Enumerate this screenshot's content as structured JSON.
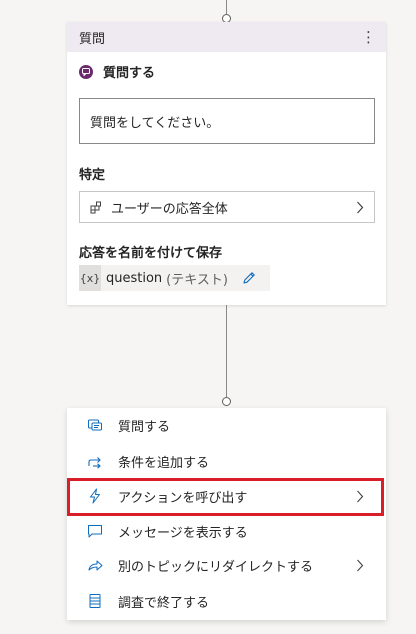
{
  "card": {
    "title": "質問",
    "kebab": "⋮",
    "section_title": "質問する",
    "prompt_text": "質問をしてください。",
    "identify_label": "特定",
    "identify_value": "ユーザーの応答全体",
    "save_label": "応答を名前を付けて保存",
    "variable_badge": "{x}",
    "variable_name": "question",
    "variable_type": "(テキスト)"
  },
  "menu": {
    "items": [
      {
        "label": "質問する",
        "icon": "question-icon",
        "has_submenu": false
      },
      {
        "label": "条件を追加する",
        "icon": "branch-icon",
        "has_submenu": false
      },
      {
        "label": "アクションを呼び出す",
        "icon": "lightning-icon",
        "has_submenu": true
      },
      {
        "label": "メッセージを表示する",
        "icon": "message-icon",
        "has_submenu": false
      },
      {
        "label": "別のトピックにリダイレクトする",
        "icon": "redirect-icon",
        "has_submenu": true
      },
      {
        "label": "調査で終了する",
        "icon": "survey-icon",
        "has_submenu": false
      }
    ]
  },
  "colors": {
    "accent_purple": "#6b2a6b",
    "header_bg": "#efe9f2",
    "icon_teal": "#0f6cbd",
    "highlight_red": "#d91e2a"
  }
}
